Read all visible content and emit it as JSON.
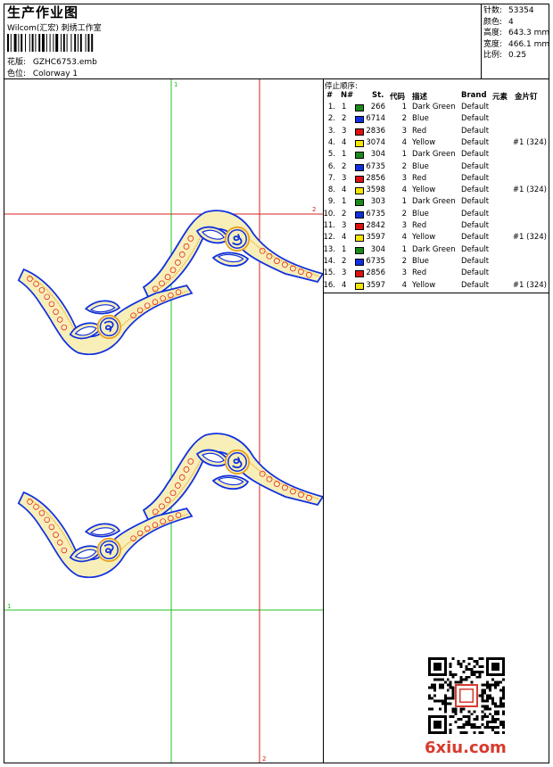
{
  "header": {
    "title": "生产作业图",
    "studio": "Wilcom(汇宏) 刺绣工作室",
    "design_label": "花版:",
    "design_value": "GZHC6753.emb",
    "colorway_label": "色位:",
    "colorway_value": "Colorway 1"
  },
  "stats": [
    {
      "label": "针数:",
      "value": "53354"
    },
    {
      "label": "颜色:",
      "value": "4"
    },
    {
      "label": "高度:",
      "value": "643.3 mm"
    },
    {
      "label": "宽度:",
      "value": "466.1 mm"
    },
    {
      "label": "比例:",
      "value": "0.25"
    }
  ],
  "sequence": {
    "title": "停止顺序:",
    "headers": {
      "num": "#",
      "n": "N#",
      "st": "St.",
      "code": "代码",
      "desc": "描述",
      "brand": "Brand",
      "elem": "元素",
      "seq": "金片钉"
    },
    "rows": [
      {
        "num": "1.",
        "n": "1",
        "color": "#1a8a1a",
        "st": "266",
        "code": "1",
        "desc": "Dark Green",
        "brand": "Default",
        "seq": ""
      },
      {
        "num": "2.",
        "n": "2",
        "color": "#1030e0",
        "st": "6714",
        "code": "2",
        "desc": "Blue",
        "brand": "Default",
        "seq": ""
      },
      {
        "num": "3.",
        "n": "3",
        "color": "#e01010",
        "st": "2836",
        "code": "3",
        "desc": "Red",
        "brand": "Default",
        "seq": ""
      },
      {
        "num": "4.",
        "n": "4",
        "color": "#f5e600",
        "st": "3074",
        "code": "4",
        "desc": "Yellow",
        "brand": "Default",
        "seq": "#1 (324)"
      },
      {
        "num": "5.",
        "n": "1",
        "color": "#1a8a1a",
        "st": "304",
        "code": "1",
        "desc": "Dark Green",
        "brand": "Default",
        "seq": ""
      },
      {
        "num": "6.",
        "n": "2",
        "color": "#1030e0",
        "st": "6735",
        "code": "2",
        "desc": "Blue",
        "brand": "Default",
        "seq": ""
      },
      {
        "num": "7.",
        "n": "3",
        "color": "#e01010",
        "st": "2856",
        "code": "3",
        "desc": "Red",
        "brand": "Default",
        "seq": ""
      },
      {
        "num": "8.",
        "n": "4",
        "color": "#f5e600",
        "st": "3598",
        "code": "4",
        "desc": "Yellow",
        "brand": "Default",
        "seq": "#1 (324)"
      },
      {
        "num": "9.",
        "n": "1",
        "color": "#1a8a1a",
        "st": "303",
        "code": "1",
        "desc": "Dark Green",
        "brand": "Default",
        "seq": ""
      },
      {
        "num": "10.",
        "n": "2",
        "color": "#1030e0",
        "st": "6735",
        "code": "2",
        "desc": "Blue",
        "brand": "Default",
        "seq": ""
      },
      {
        "num": "11.",
        "n": "3",
        "color": "#e01010",
        "st": "2842",
        "code": "3",
        "desc": "Red",
        "brand": "Default",
        "seq": ""
      },
      {
        "num": "12.",
        "n": "4",
        "color": "#f5e600",
        "st": "3597",
        "code": "4",
        "desc": "Yellow",
        "brand": "Default",
        "seq": "#1 (324)"
      },
      {
        "num": "13.",
        "n": "1",
        "color": "#1a8a1a",
        "st": "304",
        "code": "1",
        "desc": "Dark Green",
        "brand": "Default",
        "seq": ""
      },
      {
        "num": "14.",
        "n": "2",
        "color": "#1030e0",
        "st": "6735",
        "code": "2",
        "desc": "Blue",
        "brand": "Default",
        "seq": ""
      },
      {
        "num": "15.",
        "n": "3",
        "color": "#e01010",
        "st": "2856",
        "code": "3",
        "desc": "Red",
        "brand": "Default",
        "seq": ""
      },
      {
        "num": "16.",
        "n": "4",
        "color": "#f5e600",
        "st": "3597",
        "code": "4",
        "desc": "Yellow",
        "brand": "Default",
        "seq": "#1 (324)"
      }
    ]
  },
  "markers": {
    "one": "1",
    "two": "2"
  },
  "watermark": "6xiu.com",
  "colors": {
    "guide_green": "#22c022",
    "guide_red": "#d42020",
    "outline_blue": "#1030e0",
    "fill_cream": "#f8efb8",
    "satin_orange": "#e8a020"
  }
}
